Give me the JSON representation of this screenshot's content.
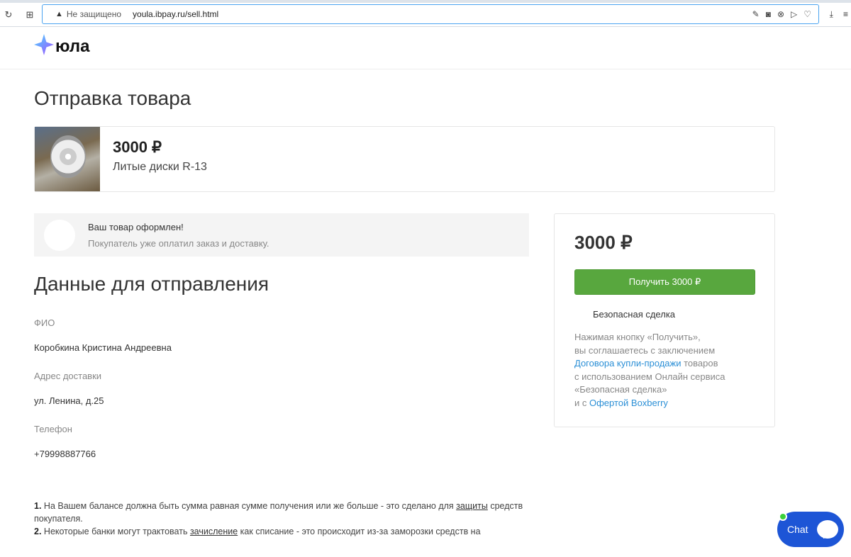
{
  "browser": {
    "security": "Не защищено",
    "url": "youla.ibpay.ru/sell.html"
  },
  "logo": "юла",
  "page_title": "Отправка товара",
  "product": {
    "price": "3000 ₽",
    "name": "Литые диски R-13"
  },
  "notice": {
    "title": "Ваш товар оформлен!",
    "subtitle": "Покупатель уже оплатил заказ и доставку."
  },
  "shipping": {
    "title": "Данные для отправления",
    "fields": [
      {
        "label": "ФИО",
        "value": "Коробкина Кристина Андреевна"
      },
      {
        "label": "Адрес доставки",
        "value": "ул. Ленина, д.25"
      },
      {
        "label": "Телефон",
        "value": "+79998887766"
      }
    ]
  },
  "sidebar": {
    "price": "3000 ₽",
    "button": "Получить 3000 ₽",
    "safe_deal": "Безопасная сделка",
    "terms": {
      "l1": "Нажимая кнопку «Получить»,",
      "l2": "вы соглашаетесь с заключением",
      "link1": "Договора купли-продажи",
      "l3": " товаров",
      "l4": "с использованием Онлайн сервиса",
      "l5": "«Безопасная сделка»",
      "l6": "и с ",
      "link2": "Офертой Boxberry"
    }
  },
  "notes": {
    "n1num": "1.",
    "n1a": " На Вашем балансе должна быть сумма равная сумме получения или же больше - это сделано для ",
    "n1link": "защиты",
    "n1b": " средств покупателя.",
    "n2num": "2.",
    "n2a": " Некоторые банки могут трактовать ",
    "n2link": "зачисление",
    "n2b": " как списание - это происходит из-за заморозки средств на"
  },
  "chat": {
    "label": "Chat"
  }
}
